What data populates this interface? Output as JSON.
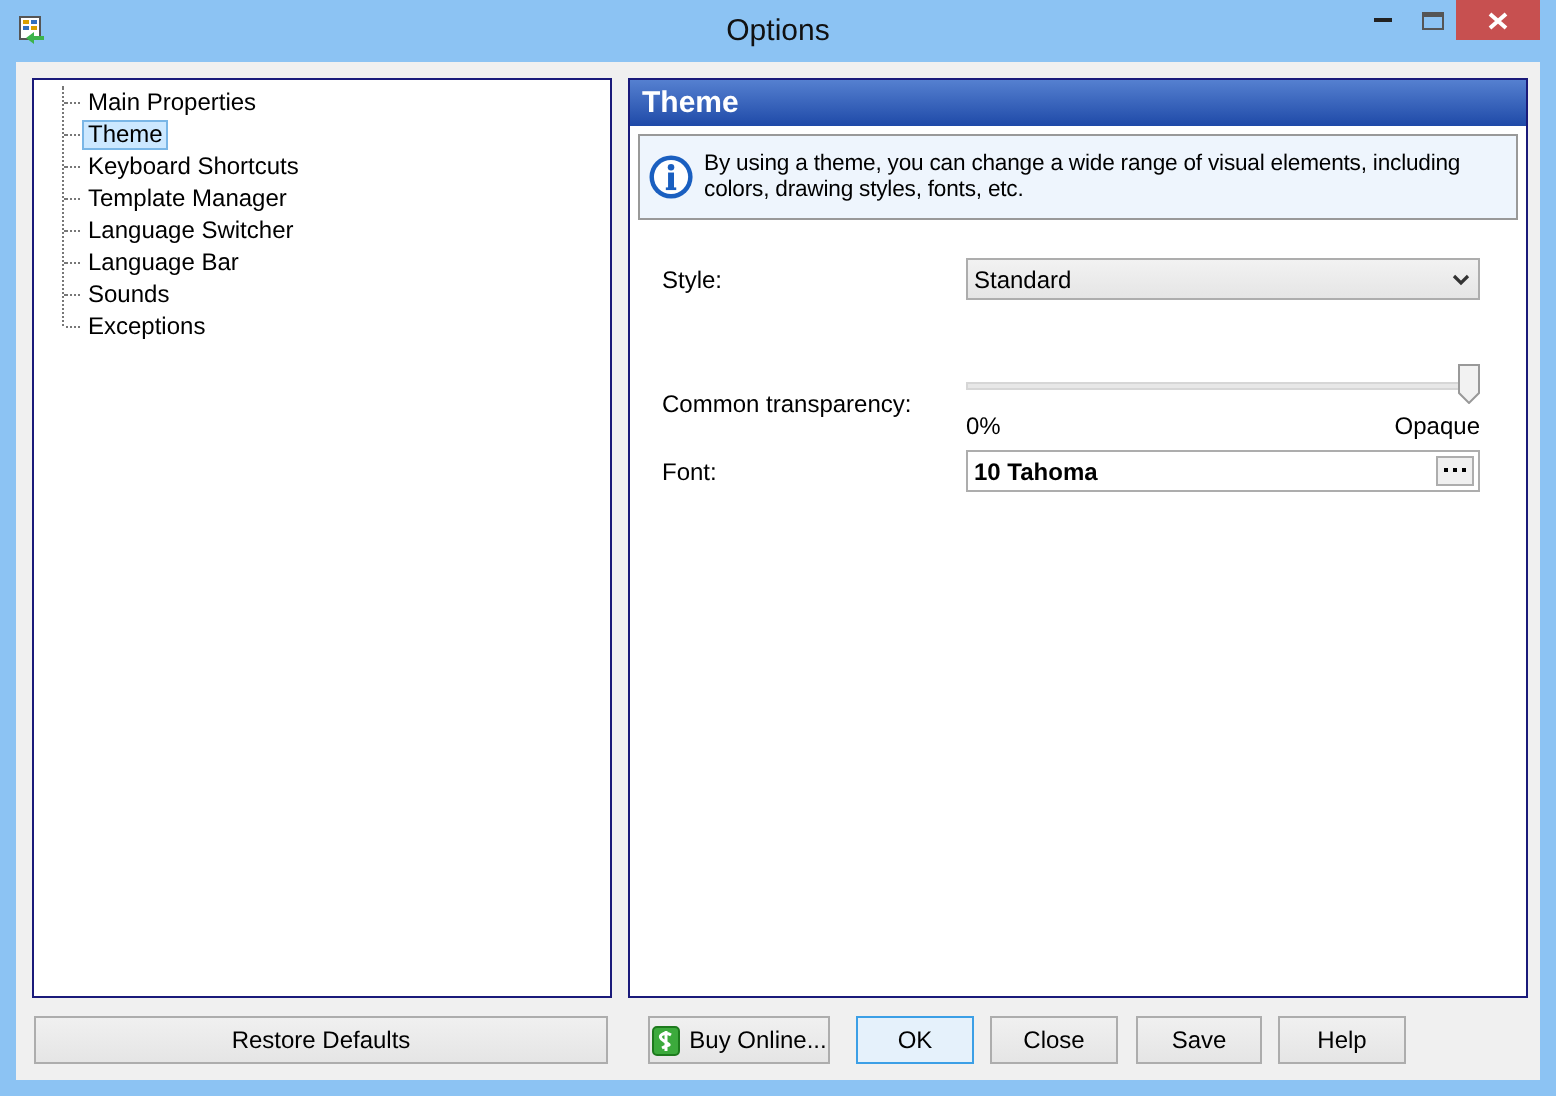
{
  "window": {
    "title": "Options"
  },
  "tree": {
    "items": [
      {
        "label": "Main Properties",
        "selected": false
      },
      {
        "label": "Theme",
        "selected": true
      },
      {
        "label": "Keyboard Shortcuts",
        "selected": false
      },
      {
        "label": "Template Manager",
        "selected": false
      },
      {
        "label": "Language Switcher",
        "selected": false
      },
      {
        "label": "Language Bar",
        "selected": false
      },
      {
        "label": "Sounds",
        "selected": false
      },
      {
        "label": "Exceptions",
        "selected": false
      }
    ]
  },
  "panel": {
    "title": "Theme",
    "info": "By using a theme, you can change a wide range of visual elements, including colors, drawing styles, fonts, etc.",
    "style": {
      "label": "Style:",
      "value": "Standard"
    },
    "transparency": {
      "label": "Common transparency:",
      "level": 1,
      "min_label": "0%",
      "max_label": "Opaque"
    },
    "font": {
      "label": "Font:",
      "value": "10 Tahoma"
    }
  },
  "buttons": [
    {
      "label": "Restore Defaults",
      "kind": "plain",
      "focused": false
    },
    {
      "label": "Buy Online...",
      "kind": "buy",
      "focused": false
    },
    {
      "label": "OK",
      "kind": "plain",
      "focused": true
    },
    {
      "label": "Close",
      "kind": "plain",
      "focused": false
    },
    {
      "label": "Save",
      "kind": "plain",
      "focused": false
    },
    {
      "label": "Help",
      "kind": "plain",
      "focused": false
    }
  ]
}
